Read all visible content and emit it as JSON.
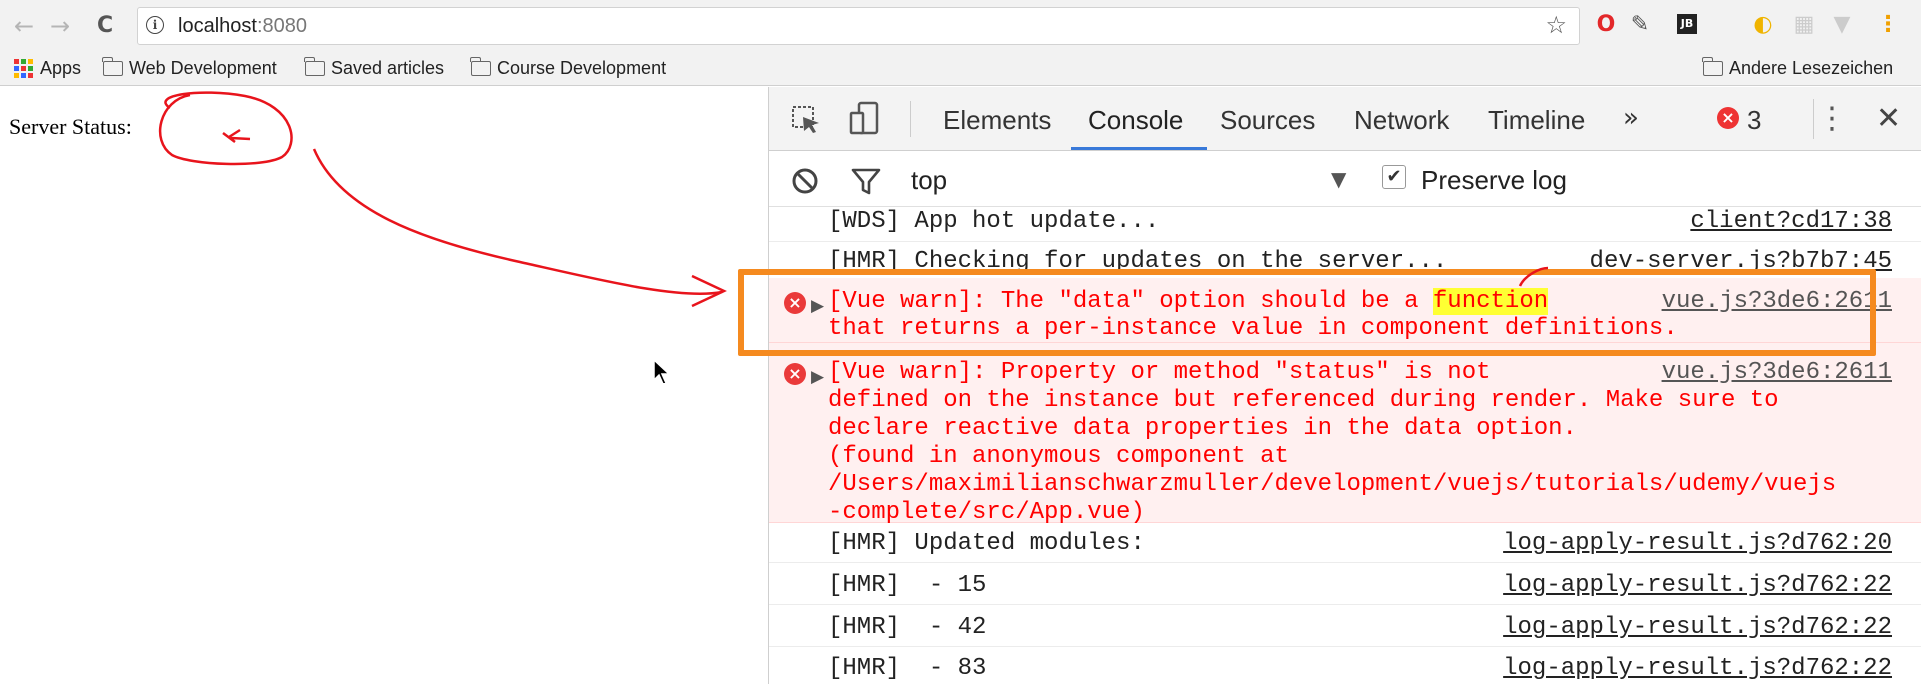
{
  "browser": {
    "nav": {
      "back": "←",
      "forward": "→",
      "reload": "C"
    },
    "url_host": "localhost",
    "url_port": ":8080"
  },
  "bookmarks": {
    "apps_label": "Apps",
    "items": [
      "Web Development",
      "Saved articles",
      "Course Development"
    ],
    "other_label": "Andere Lesezeichen"
  },
  "page": {
    "server_status_label": "Server Status:"
  },
  "devtools": {
    "tabs": [
      "Elements",
      "Console",
      "Sources",
      "Network",
      "Timeline"
    ],
    "more": "»",
    "active_tab": "Console",
    "error_count": "3",
    "context": "top",
    "preserve_log_label": "Preserve log",
    "preserve_log_checked": true
  },
  "console": {
    "messages": [
      {
        "text": "[WDS] App hot update...",
        "source": "client?cd17:38",
        "level": "log"
      },
      {
        "text": "[HMR] Checking for updates on the server...",
        "source": "dev-server.js?b7b7:45",
        "level": "log"
      },
      {
        "text_pre": "[Vue warn]: The \"data\" option should be a ",
        "text_highlight": "function",
        "text_line2": "that returns a per-instance value in component definitions.",
        "source": "vue.js?3de6:2611",
        "level": "error"
      },
      {
        "lines": [
          "[Vue warn]: Property or method \"status\" is not",
          "defined on the instance but referenced during render. Make sure to",
          "declare reactive data properties in the data option.",
          "(found in anonymous component at",
          "/Users/maximilianschwarzmuller/development/vuejs/tutorials/udemy/vuejs",
          "-complete/src/App.vue)"
        ],
        "source": "vue.js?3de6:2611",
        "level": "error"
      },
      {
        "text": "[HMR] Updated modules:",
        "source": "log-apply-result.js?d762:20",
        "level": "log"
      },
      {
        "text": "[HMR]  - 15",
        "source": "log-apply-result.js?d762:22",
        "level": "log"
      },
      {
        "text": "[HMR]  - 42",
        "source": "log-apply-result.js?d762:22",
        "level": "log"
      },
      {
        "text": "[HMR]  - 83",
        "source": "log-apply-result.js?d762:22",
        "level": "log"
      }
    ]
  },
  "colors": {
    "error_text": "#ff0000",
    "error_bg": "#fff0f0",
    "annotation_red": "#e8141c",
    "annotation_orange": "#f58a1f",
    "tab_underline": "#3879d9"
  }
}
